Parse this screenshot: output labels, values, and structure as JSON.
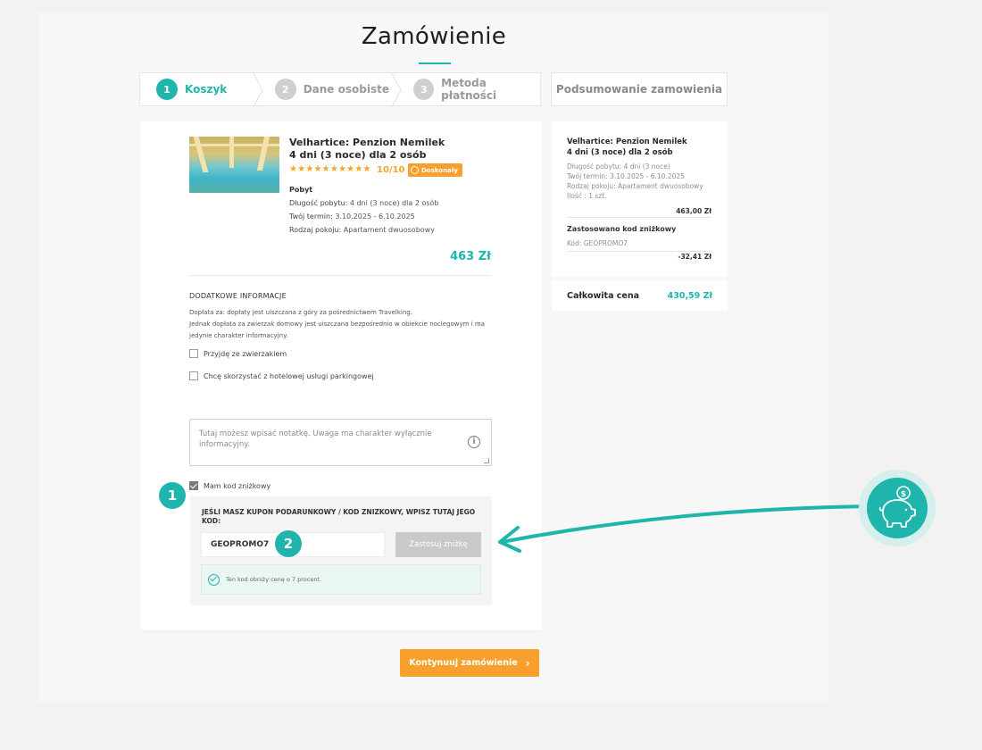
{
  "page": {
    "title": "Zamówienie"
  },
  "steps": [
    {
      "num": "1",
      "label": "Koszyk"
    },
    {
      "num": "2",
      "label": "Dane osobiste"
    },
    {
      "num": "3",
      "label": "Metoda płatności"
    }
  ],
  "summary_tab": "Podsumowanie zamowienia",
  "product": {
    "name_line1": "Velhartice: Penzion Nemilek",
    "name_line2": "4 dni (3 noce) dla 2 osób",
    "stars": "★★★★★★★★★★",
    "rating": "10/10",
    "badge": "Doskonały",
    "section": "Pobyt",
    "length_label": "Długość pobytu:",
    "length_value": "4 dni (3 noce) dla 2 osób",
    "term_label": "Twój termin:",
    "term_value": "3.10.2025 - 6.10.2025",
    "room_label": "Rodzaj pokoju:",
    "room_value": "Apartament dwuosobowy",
    "price": "463 Zł"
  },
  "extra": {
    "title": "DODATKOWE INFORMACJE",
    "line1": "Dopłata za: dopłaty jest uiszczana z góry za pośrednictwem Travelking.",
    "line2": "Jednak dopłata za zwierzak domowy jest uiszczana bezpośrednio w obiekcie noclegowym i ma jedynie charakter informacyjny.",
    "pet_label": "Przyjdę ze zwierzakiem",
    "parking_label": "Chcę skorzystać z hotelowej usługi parkingowej",
    "note_placeholder": "Tutaj możesz wpisać notatkę. Uwaga ma charakter wyłącznie informacyjny."
  },
  "coupon": {
    "checkbox_label": "Mam kod zniżkowy",
    "prompt": "JEŚLI MASZ KUPON PODARUNKOWY / KOD ZNIZKOWY, WPISZ TUTAJ JEGO KOD:",
    "code": "GEOPROMO7",
    "apply_label": "Zastosuj zniżkę",
    "success": "Ten kod obniży cenę o 7 procent."
  },
  "markers": {
    "one": "1",
    "two": "2"
  },
  "summary": {
    "name_line1": "Velhartice: Penzion Nemilek",
    "name_line2": "4 dni (3 noce) dla 2 osób",
    "length": "Długość pobytu: 4 dni (3 noce)",
    "term": "Twój termin: 3.10.2025 - 6.10.2025",
    "room": "Rodzaj pokoju: Apartament dwuosobowy",
    "qty": "Ilość : 1 szt.",
    "price": "463,00 Zł",
    "discount_title": "Zastosowano kod zniżkowy",
    "discount_code": "Kód: GEOPROMO7",
    "discount_value": "-32,41 Zł",
    "total_label": "Całkowita cena",
    "total_value": "430,59 Zł"
  },
  "continue_label": "Kontynuuj zamówienie",
  "icons": {
    "info": "i",
    "continue_chevron": "›",
    "piggy": "piggy-bank-icon"
  },
  "colors": {
    "accent": "#1fb5ad",
    "cta": "#f7a02e",
    "stars": "#f5a623"
  }
}
